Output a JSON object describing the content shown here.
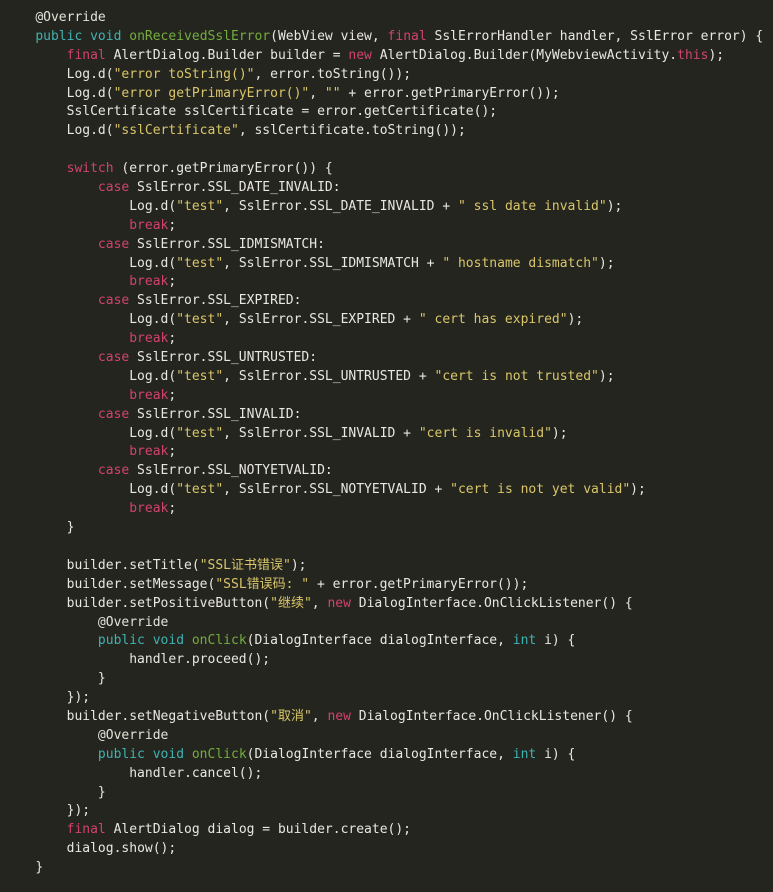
{
  "editor": {
    "language": "Java",
    "background_color": "#24251e",
    "default_text_color": "#e8e8e0",
    "theme_colors": {
      "keyword": "#3fb2b2",
      "control_keyword": "#d2436b",
      "string": "#d9c66a",
      "method_declaration": "#74ad3e",
      "annotation": "#e3e3d8",
      "plain": "#e8e8e0"
    }
  },
  "code": {
    "lines": [
      {
        "n": 1,
        "indent": 1,
        "segments": [
          {
            "t": "@Override",
            "c": "anno"
          }
        ]
      },
      {
        "n": 2,
        "indent": 1,
        "segments": [
          {
            "t": "public",
            "c": "kw"
          },
          {
            "t": " ",
            "c": "plain"
          },
          {
            "t": "void",
            "c": "kw"
          },
          {
            "t": " ",
            "c": "plain"
          },
          {
            "t": "onReceivedSslError",
            "c": "fn"
          },
          {
            "t": "(WebView view, ",
            "c": "plain"
          },
          {
            "t": "final",
            "c": "ctrl"
          },
          {
            "t": " SslErrorHandler handler, SslError error) {",
            "c": "plain"
          }
        ]
      },
      {
        "n": 3,
        "indent": 2,
        "segments": [
          {
            "t": "final",
            "c": "ctrl"
          },
          {
            "t": " AlertDialog.Builder builder = ",
            "c": "plain"
          },
          {
            "t": "new",
            "c": "ctrl"
          },
          {
            "t": " AlertDialog.Builder(MyWebviewActivity.",
            "c": "plain"
          },
          {
            "t": "this",
            "c": "ctrl"
          },
          {
            "t": ");",
            "c": "plain"
          }
        ]
      },
      {
        "n": 4,
        "indent": 2,
        "segments": [
          {
            "t": "Log.d(",
            "c": "plain"
          },
          {
            "t": "\"error toString()\"",
            "c": "str"
          },
          {
            "t": ", error.toString());",
            "c": "plain"
          }
        ]
      },
      {
        "n": 5,
        "indent": 2,
        "segments": [
          {
            "t": "Log.d(",
            "c": "plain"
          },
          {
            "t": "\"error getPrimaryError()\"",
            "c": "str"
          },
          {
            "t": ", ",
            "c": "plain"
          },
          {
            "t": "\"\"",
            "c": "str"
          },
          {
            "t": " + error.getPrimaryError());",
            "c": "plain"
          }
        ]
      },
      {
        "n": 6,
        "indent": 2,
        "segments": [
          {
            "t": "SslCertificate sslCertificate = error.getCertificate();",
            "c": "plain"
          }
        ]
      },
      {
        "n": 7,
        "indent": 2,
        "segments": [
          {
            "t": "Log.d(",
            "c": "plain"
          },
          {
            "t": "\"sslCertificate\"",
            "c": "str"
          },
          {
            "t": ", sslCertificate.toString());",
            "c": "plain"
          }
        ]
      },
      {
        "n": 8,
        "indent": 0,
        "segments": []
      },
      {
        "n": 9,
        "indent": 2,
        "segments": [
          {
            "t": "switch",
            "c": "ctrl"
          },
          {
            "t": " (error.getPrimaryError()) {",
            "c": "plain"
          }
        ]
      },
      {
        "n": 10,
        "indent": 3,
        "segments": [
          {
            "t": "case",
            "c": "ctrl"
          },
          {
            "t": " SslError.SSL_DATE_INVALID:",
            "c": "plain"
          }
        ]
      },
      {
        "n": 11,
        "indent": 4,
        "segments": [
          {
            "t": "Log.d(",
            "c": "plain"
          },
          {
            "t": "\"test\"",
            "c": "str"
          },
          {
            "t": ", SslError.SSL_DATE_INVALID + ",
            "c": "plain"
          },
          {
            "t": "\" ssl date invalid\"",
            "c": "str"
          },
          {
            "t": ");",
            "c": "plain"
          }
        ]
      },
      {
        "n": 12,
        "indent": 4,
        "segments": [
          {
            "t": "break",
            "c": "ctrl"
          },
          {
            "t": ";",
            "c": "plain"
          }
        ]
      },
      {
        "n": 13,
        "indent": 3,
        "segments": [
          {
            "t": "case",
            "c": "ctrl"
          },
          {
            "t": " SslError.SSL_IDMISMATCH:",
            "c": "plain"
          }
        ]
      },
      {
        "n": 14,
        "indent": 4,
        "segments": [
          {
            "t": "Log.d(",
            "c": "plain"
          },
          {
            "t": "\"test\"",
            "c": "str"
          },
          {
            "t": ", SslError.SSL_IDMISMATCH + ",
            "c": "plain"
          },
          {
            "t": "\" hostname dismatch\"",
            "c": "str"
          },
          {
            "t": ");",
            "c": "plain"
          }
        ]
      },
      {
        "n": 15,
        "indent": 4,
        "segments": [
          {
            "t": "break",
            "c": "ctrl"
          },
          {
            "t": ";",
            "c": "plain"
          }
        ]
      },
      {
        "n": 16,
        "indent": 3,
        "segments": [
          {
            "t": "case",
            "c": "ctrl"
          },
          {
            "t": " SslError.SSL_EXPIRED:",
            "c": "plain"
          }
        ]
      },
      {
        "n": 17,
        "indent": 4,
        "segments": [
          {
            "t": "Log.d(",
            "c": "plain"
          },
          {
            "t": "\"test\"",
            "c": "str"
          },
          {
            "t": ", SslError.SSL_EXPIRED + ",
            "c": "plain"
          },
          {
            "t": "\" cert has expired\"",
            "c": "str"
          },
          {
            "t": ");",
            "c": "plain"
          }
        ]
      },
      {
        "n": 18,
        "indent": 4,
        "segments": [
          {
            "t": "break",
            "c": "ctrl"
          },
          {
            "t": ";",
            "c": "plain"
          }
        ]
      },
      {
        "n": 19,
        "indent": 3,
        "segments": [
          {
            "t": "case",
            "c": "ctrl"
          },
          {
            "t": " SslError.SSL_UNTRUSTED:",
            "c": "plain"
          }
        ]
      },
      {
        "n": 20,
        "indent": 4,
        "segments": [
          {
            "t": "Log.d(",
            "c": "plain"
          },
          {
            "t": "\"test\"",
            "c": "str"
          },
          {
            "t": ", SslError.SSL_UNTRUSTED + ",
            "c": "plain"
          },
          {
            "t": "\"cert is not trusted\"",
            "c": "str"
          },
          {
            "t": ");",
            "c": "plain"
          }
        ]
      },
      {
        "n": 21,
        "indent": 4,
        "segments": [
          {
            "t": "break",
            "c": "ctrl"
          },
          {
            "t": ";",
            "c": "plain"
          }
        ]
      },
      {
        "n": 22,
        "indent": 3,
        "segments": [
          {
            "t": "case",
            "c": "ctrl"
          },
          {
            "t": " SslError.SSL_INVALID:",
            "c": "plain"
          }
        ]
      },
      {
        "n": 23,
        "indent": 4,
        "segments": [
          {
            "t": "Log.d(",
            "c": "plain"
          },
          {
            "t": "\"test\"",
            "c": "str"
          },
          {
            "t": ", SslError.SSL_INVALID + ",
            "c": "plain"
          },
          {
            "t": "\"cert is invalid\"",
            "c": "str"
          },
          {
            "t": ");",
            "c": "plain"
          }
        ]
      },
      {
        "n": 24,
        "indent": 4,
        "segments": [
          {
            "t": "break",
            "c": "ctrl"
          },
          {
            "t": ";",
            "c": "plain"
          }
        ]
      },
      {
        "n": 25,
        "indent": 3,
        "segments": [
          {
            "t": "case",
            "c": "ctrl"
          },
          {
            "t": " SslError.SSL_NOTYETVALID:",
            "c": "plain"
          }
        ]
      },
      {
        "n": 26,
        "indent": 4,
        "segments": [
          {
            "t": "Log.d(",
            "c": "plain"
          },
          {
            "t": "\"test\"",
            "c": "str"
          },
          {
            "t": ", SslError.SSL_NOTYETVALID + ",
            "c": "plain"
          },
          {
            "t": "\"cert is not yet valid\"",
            "c": "str"
          },
          {
            "t": ");",
            "c": "plain"
          }
        ]
      },
      {
        "n": 27,
        "indent": 4,
        "segments": [
          {
            "t": "break",
            "c": "ctrl"
          },
          {
            "t": ";",
            "c": "plain"
          }
        ]
      },
      {
        "n": 28,
        "indent": 2,
        "segments": [
          {
            "t": "}",
            "c": "plain"
          }
        ]
      },
      {
        "n": 29,
        "indent": 0,
        "segments": []
      },
      {
        "n": 30,
        "indent": 2,
        "segments": [
          {
            "t": "builder.setTitle(",
            "c": "plain"
          },
          {
            "t": "\"SSL证书错误\"",
            "c": "str"
          },
          {
            "t": ");",
            "c": "plain"
          }
        ]
      },
      {
        "n": 31,
        "indent": 2,
        "segments": [
          {
            "t": "builder.setMessage(",
            "c": "plain"
          },
          {
            "t": "\"SSL错误码: \"",
            "c": "str"
          },
          {
            "t": " + error.getPrimaryError());",
            "c": "plain"
          }
        ]
      },
      {
        "n": 32,
        "indent": 2,
        "segments": [
          {
            "t": "builder.setPositiveButton(",
            "c": "plain"
          },
          {
            "t": "\"继续\"",
            "c": "str"
          },
          {
            "t": ", ",
            "c": "plain"
          },
          {
            "t": "new",
            "c": "ctrl"
          },
          {
            "t": " DialogInterface.OnClickListener() {",
            "c": "plain"
          }
        ]
      },
      {
        "n": 33,
        "indent": 3,
        "segments": [
          {
            "t": "@Override",
            "c": "anno"
          }
        ]
      },
      {
        "n": 34,
        "indent": 3,
        "segments": [
          {
            "t": "public",
            "c": "kw"
          },
          {
            "t": " ",
            "c": "plain"
          },
          {
            "t": "void",
            "c": "kw"
          },
          {
            "t": " ",
            "c": "plain"
          },
          {
            "t": "onClick",
            "c": "fn"
          },
          {
            "t": "(DialogInterface dialogInterface, ",
            "c": "plain"
          },
          {
            "t": "int",
            "c": "kw"
          },
          {
            "t": " i) {",
            "c": "plain"
          }
        ]
      },
      {
        "n": 35,
        "indent": 4,
        "segments": [
          {
            "t": "handler.proceed();",
            "c": "plain"
          }
        ]
      },
      {
        "n": 36,
        "indent": 3,
        "segments": [
          {
            "t": "}",
            "c": "plain"
          }
        ]
      },
      {
        "n": 37,
        "indent": 2,
        "segments": [
          {
            "t": "});",
            "c": "plain"
          }
        ]
      },
      {
        "n": 38,
        "indent": 2,
        "segments": [
          {
            "t": "builder.setNegativeButton(",
            "c": "plain"
          },
          {
            "t": "\"取消\"",
            "c": "str"
          },
          {
            "t": ", ",
            "c": "plain"
          },
          {
            "t": "new",
            "c": "ctrl"
          },
          {
            "t": " DialogInterface.OnClickListener() {",
            "c": "plain"
          }
        ]
      },
      {
        "n": 39,
        "indent": 3,
        "segments": [
          {
            "t": "@Override",
            "c": "anno"
          }
        ]
      },
      {
        "n": 40,
        "indent": 3,
        "segments": [
          {
            "t": "public",
            "c": "kw"
          },
          {
            "t": " ",
            "c": "plain"
          },
          {
            "t": "void",
            "c": "kw"
          },
          {
            "t": " ",
            "c": "plain"
          },
          {
            "t": "onClick",
            "c": "fn"
          },
          {
            "t": "(DialogInterface dialogInterface, ",
            "c": "plain"
          },
          {
            "t": "int",
            "c": "kw"
          },
          {
            "t": " i) {",
            "c": "plain"
          }
        ]
      },
      {
        "n": 41,
        "indent": 4,
        "segments": [
          {
            "t": "handler.cancel();",
            "c": "plain"
          }
        ]
      },
      {
        "n": 42,
        "indent": 3,
        "segments": [
          {
            "t": "}",
            "c": "plain"
          }
        ]
      },
      {
        "n": 43,
        "indent": 2,
        "segments": [
          {
            "t": "});",
            "c": "plain"
          }
        ]
      },
      {
        "n": 44,
        "indent": 2,
        "segments": [
          {
            "t": "final",
            "c": "ctrl"
          },
          {
            "t": " AlertDialog dialog = builder.create();",
            "c": "plain"
          }
        ]
      },
      {
        "n": 45,
        "indent": 2,
        "segments": [
          {
            "t": "dialog.show();",
            "c": "plain"
          }
        ]
      },
      {
        "n": 46,
        "indent": 1,
        "segments": [
          {
            "t": "}",
            "c": "plain"
          }
        ]
      }
    ]
  }
}
